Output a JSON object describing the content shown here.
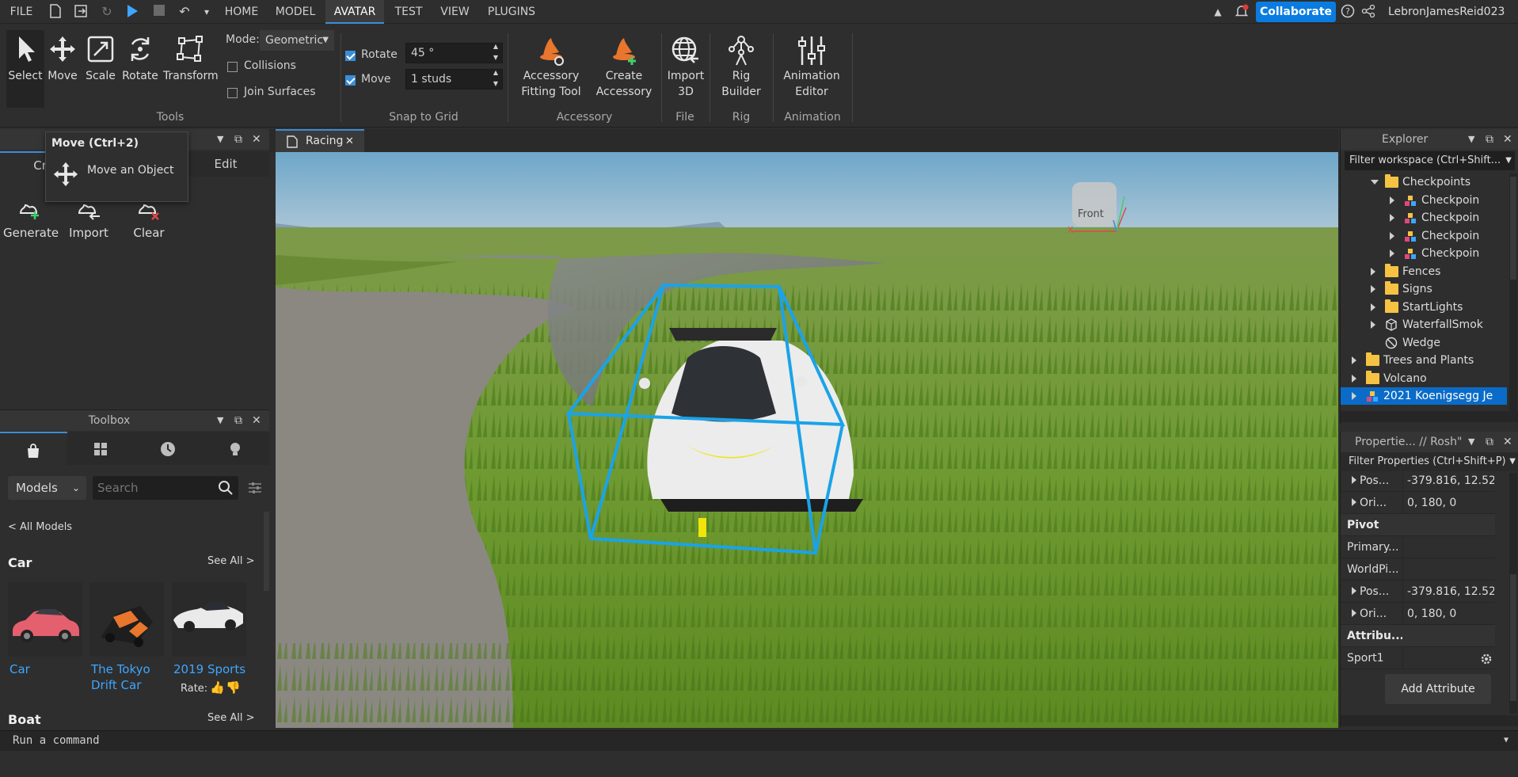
{
  "menubar": {
    "file_label": "FILE",
    "tabs": [
      "HOME",
      "MODEL",
      "AVATAR",
      "TEST",
      "VIEW",
      "PLUGINS"
    ],
    "active_tab": "AVATAR",
    "collaborate_label": "Collaborate",
    "username": "LebronJamesReid023"
  },
  "ribbon": {
    "tools": [
      {
        "label": "Select",
        "icon": "cursor-icon"
      },
      {
        "label": "Move",
        "icon": "move-icon"
      },
      {
        "label": "Scale",
        "icon": "scale-icon"
      },
      {
        "label": "Rotate",
        "icon": "rotate-icon"
      },
      {
        "label": "Transform",
        "icon": "transform-icon"
      }
    ],
    "mode_label": "Mode:",
    "mode_value": "Geometric",
    "collisions_label": "Collisions",
    "join_surfaces_label": "Join Surfaces",
    "tools_group": "Tools",
    "rotate_label": "Rotate",
    "rotate_value": "45 °",
    "move_label": "Move",
    "move_value": "1 studs",
    "snap_group": "Snap to Grid",
    "accessory_fitting_label_1": "Accessory",
    "accessory_fitting_label_2": "Fitting Tool",
    "create_accessory_label_1": "Create",
    "create_accessory_label_2": "Accessory",
    "accessory_group": "Accessory",
    "import3d_label_1": "Import",
    "import3d_label_2": "3D",
    "file_group": "File",
    "rig_builder_label_1": "Rig",
    "rig_builder_label_2": "Builder",
    "rig_group": "Rig",
    "anim_editor_label_1": "Animation",
    "anim_editor_label_2": "Editor",
    "animation_group": "Animation"
  },
  "tooltip": {
    "title": "Move (Ctrl+2)",
    "description": "Move an Object"
  },
  "terrain_panel": {
    "tab_create": "Cre",
    "tab_edit": "Edit",
    "buttons": [
      {
        "label": "Generate"
      },
      {
        "label": "Import"
      },
      {
        "label": "Clear"
      }
    ]
  },
  "toolbox": {
    "title": "Toolbox",
    "category": "Models",
    "search_placeholder": "Search",
    "all_models": "< All Models",
    "sections": [
      {
        "title": "Car",
        "see_all": "See All >"
      },
      {
        "title": "Boat",
        "see_all": "See All >"
      }
    ],
    "items": [
      {
        "name": "Car"
      },
      {
        "name": "The Tokyo Drift Car"
      },
      {
        "name": "2019 Sports"
      }
    ],
    "rate_label": "Rate:"
  },
  "document": {
    "tab_label": "Racing"
  },
  "viewport": {
    "view_cube_label": "Front",
    "axis_x": "X"
  },
  "explorer": {
    "title": "Explorer",
    "filter_placeholder": "Filter workspace (Ctrl+Shift...",
    "items": [
      {
        "label": "Checkpoints",
        "depth": 3,
        "expanded": true,
        "icon": "folder"
      },
      {
        "label": "Checkpoin",
        "depth": 4,
        "expanded": false,
        "icon": "model"
      },
      {
        "label": "Checkpoin",
        "depth": 4,
        "expanded": false,
        "icon": "model"
      },
      {
        "label": "Checkpoin",
        "depth": 4,
        "expanded": false,
        "icon": "model"
      },
      {
        "label": "Checkpoin",
        "depth": 4,
        "expanded": false,
        "icon": "model"
      },
      {
        "label": "Fences",
        "depth": 3,
        "expanded": false,
        "icon": "folder"
      },
      {
        "label": "Signs",
        "depth": 3,
        "expanded": false,
        "icon": "folder"
      },
      {
        "label": "StartLights",
        "depth": 3,
        "expanded": false,
        "icon": "folder"
      },
      {
        "label": "WaterfallSmok",
        "depth": 3,
        "expanded": false,
        "icon": "part"
      },
      {
        "label": "Wedge",
        "depth": 3,
        "expanded": null,
        "icon": "wedge"
      },
      {
        "label": "Trees and Plants",
        "depth": 2,
        "expanded": false,
        "icon": "folder"
      },
      {
        "label": "Volcano",
        "depth": 2,
        "expanded": false,
        "icon": "folder"
      },
      {
        "label": "2021 Koenigsegg Je",
        "depth": 2,
        "expanded": false,
        "icon": "model",
        "selected": true
      }
    ]
  },
  "properties": {
    "title": "Propertie... // Rosh\"",
    "filter_placeholder": "Filter Properties (Ctrl+Shift+P)",
    "rows": [
      {
        "key": "Pos...",
        "value": "-379.816, 12.524...",
        "expandable": true
      },
      {
        "key": "Ori...",
        "value": "0, 180, 0",
        "expandable": true
      },
      {
        "key": "Pivot",
        "value": "",
        "header": true
      },
      {
        "key": "Primary...",
        "value": ""
      },
      {
        "key": "WorldPi...",
        "value": ""
      },
      {
        "key": "Pos...",
        "value": "-379.816, 12.524...",
        "expandable": true
      },
      {
        "key": "Ori...",
        "value": "0, 180, 0",
        "expandable": true
      },
      {
        "key": "Attribu...",
        "value": "",
        "header": true
      },
      {
        "key": "Sport1",
        "value": "",
        "gear": true
      }
    ],
    "add_attribute": "Add Attribute"
  },
  "command_bar": {
    "placeholder": "Run a command"
  },
  "colors": {
    "accent": "#3b8ed6",
    "collaborate": "#0a7ce0",
    "link": "#3ea6ff",
    "selection_box": "#1aa3e8"
  }
}
